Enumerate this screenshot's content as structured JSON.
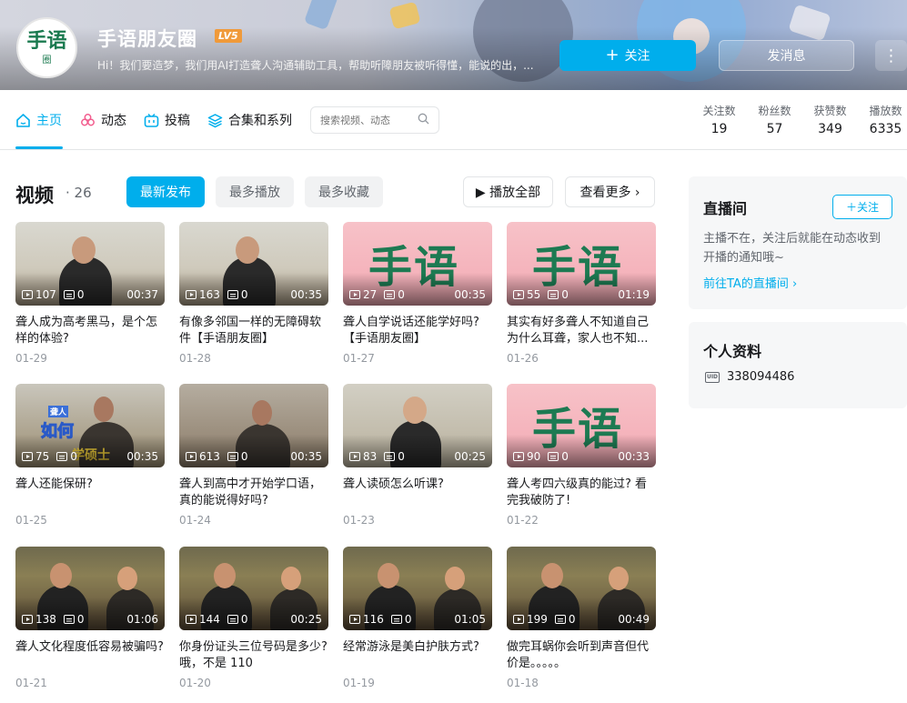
{
  "header": {
    "avatar_text_main": "手语",
    "avatar_text_sub": "圈",
    "username": "手语朋友圈",
    "level": "LV5",
    "sign": "Hi！我们要造梦，我们用AI打造聋人沟通辅助工具，帮助听障朋友被听得懂，能说的出，...",
    "follow_label": "关注",
    "message_label": "发消息",
    "more_label": "⋮",
    "follow_icon": "plus-icon"
  },
  "nav": {
    "tabs": [
      {
        "label": "主页",
        "icon": "home-icon"
      },
      {
        "label": "动态",
        "icon": "pinwheel-icon"
      },
      {
        "label": "投稿",
        "icon": "tv-icon"
      },
      {
        "label": "合集和系列",
        "icon": "layers-icon"
      }
    ],
    "search_placeholder": "搜索视频、动态",
    "stats": [
      {
        "label": "关注数",
        "value": "19"
      },
      {
        "label": "粉丝数",
        "value": "57"
      },
      {
        "label": "获赞数",
        "value": "349"
      },
      {
        "label": "播放数",
        "value": "6335"
      }
    ]
  },
  "videos_section": {
    "title": "视频",
    "count": "· 26",
    "sort_tabs": [
      "最新发布",
      "最多播放",
      "最多收藏"
    ],
    "play_all": "▶ 播放全部",
    "see_more": "查看更多 ›"
  },
  "videos": [
    {
      "plays": "107",
      "danmaku": "0",
      "duration": "00:37",
      "title": "聋人成为高考黑马，是个怎样的体验?",
      "date": "01-29",
      "thumb": "woman-talking"
    },
    {
      "plays": "163",
      "danmaku": "0",
      "duration": "00:35",
      "title": "有像多邻国一样的无障碍软件【手语朋友圈】",
      "date": "01-28",
      "thumb": "woman-talking"
    },
    {
      "plays": "27",
      "danmaku": "0",
      "duration": "00:35",
      "title": "聋人自学说话还能学好吗?【手语朋友圈】",
      "date": "01-27",
      "thumb": "pink-logo"
    },
    {
      "plays": "55",
      "danmaku": "0",
      "duration": "01:19",
      "title": "其实有好多聋人不知道自己为什么耳聋，家人也不知...",
      "date": "01-26",
      "thumb": "pink-logo"
    },
    {
      "plays": "75",
      "danmaku": "0",
      "duration": "00:35",
      "title": "聋人还能保研?",
      "date": "01-25",
      "thumb": "man-caption",
      "caption_small": "聋人",
      "caption_big": "如何",
      "caption_bottom": "学硕士"
    },
    {
      "plays": "613",
      "danmaku": "0",
      "duration": "00:35",
      "title": "聋人到高中才开始学口语，真的能说得好吗?",
      "date": "01-24",
      "thumb": "man-sitting"
    },
    {
      "plays": "83",
      "danmaku": "0",
      "duration": "00:25",
      "title": "聋人读硕怎么听课?",
      "date": "01-23",
      "thumb": "woman-standing"
    },
    {
      "plays": "90",
      "danmaku": "0",
      "duration": "00:33",
      "title": "聋人考四六级真的能过? 看完我破防了!",
      "date": "01-22",
      "thumb": "pink-logo"
    },
    {
      "plays": "138",
      "danmaku": "0",
      "duration": "01:06",
      "title": "聋人文化程度低容易被骗吗?",
      "date": "01-21",
      "thumb": "restaurant"
    },
    {
      "plays": "144",
      "danmaku": "0",
      "duration": "00:25",
      "title": "你身份证头三位号码是多少? 哦，不是 110",
      "date": "01-20",
      "thumb": "restaurant"
    },
    {
      "plays": "116",
      "danmaku": "0",
      "duration": "01:05",
      "title": "经常游泳是美白护肤方式?",
      "date": "01-19",
      "thumb": "restaurant"
    },
    {
      "plays": "199",
      "danmaku": "0",
      "duration": "00:49",
      "title": "做完耳蜗你会听到声音但代价是。。。。。",
      "date": "01-18",
      "thumb": "restaurant"
    }
  ],
  "pink_logo_text": "手语",
  "live_box": {
    "title": "直播间",
    "follow": "＋关注",
    "desc": "主播不在，关注后就能在动态收到开播的通知哦~",
    "link": "前往TA的直播间 ›"
  },
  "profile_box": {
    "title": "个人资料",
    "uid_icon": "uid-icon",
    "uid": "338094486"
  },
  "colors": {
    "accent": "#00aeec",
    "level": "#f09a3a",
    "logo_green": "#1d7a52"
  }
}
